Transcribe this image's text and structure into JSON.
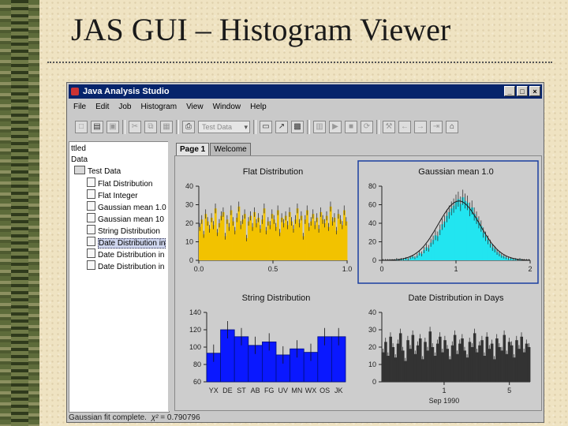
{
  "slide": {
    "title": "JAS GUI – Histogram Viewer"
  },
  "window": {
    "title": "Java Analysis Studio",
    "buttons": [
      "_",
      "□",
      "×"
    ]
  },
  "menu": [
    "File",
    "Edit",
    "Job",
    "Histogram",
    "View",
    "Window",
    "Help"
  ],
  "toolbar": {
    "combo_value": "Test Data"
  },
  "tree": {
    "root": "ttled",
    "data_label": "Data",
    "folder": "Test Data",
    "items": [
      "Flat Distribution",
      "Flat Integer",
      "Gaussian mean 1.0",
      "Gaussian mean 10",
      "String Distribution",
      "Date Distribution in",
      "Date Distribution in",
      "Date Distribution in"
    ],
    "selected_index": 5
  },
  "tabs": [
    "Page 1",
    "Welcome"
  ],
  "status": {
    "prefix": "Gaussian fit complete.",
    "symbol": "χ²",
    "value": "= 0.790796"
  },
  "colors": {
    "flat": "#f2c200",
    "gaussian": "#22e5f0",
    "string": "#0a18ff",
    "date": "#333333",
    "select_box": "#1b3fa0"
  },
  "chart_data": [
    {
      "type": "bar",
      "title": "Flat Distribution",
      "ylim": [
        0,
        40
      ],
      "yticks": [
        "40",
        "30",
        "20",
        "10",
        "0"
      ],
      "xlim": [
        0,
        1
      ],
      "xticks": [
        "0.0",
        "0.5",
        "1.0"
      ],
      "values": [
        18,
        22,
        14,
        25,
        21,
        17,
        23,
        19,
        28,
        15,
        20,
        24,
        26,
        13,
        22,
        18,
        27,
        21,
        16,
        23,
        29,
        19,
        22,
        25,
        12,
        21,
        24,
        18,
        26,
        20,
        23,
        17,
        22,
        28,
        16,
        21,
        19,
        25,
        22,
        18,
        27,
        15,
        23,
        20,
        24,
        19,
        26,
        21,
        17,
        22,
        28,
        20,
        24,
        13,
        22,
        27,
        18,
        21,
        25,
        19,
        23,
        17,
        26,
        22,
        20,
        24,
        18,
        29,
        21,
        23,
        16,
        25,
        22,
        19,
        27,
        21
      ]
    },
    {
      "type": "bar",
      "title": "Gaussian mean 1.0",
      "ylim": [
        0,
        80
      ],
      "yticks": [
        "80",
        "60",
        "40",
        "20",
        "0"
      ],
      "xlim": [
        0,
        2
      ],
      "xticks": [
        "0",
        "1",
        "2"
      ],
      "fit_line": true,
      "values": [
        0,
        0,
        0,
        0,
        0,
        0,
        1,
        0,
        1,
        1,
        2,
        1,
        3,
        4,
        3,
        5,
        8,
        7,
        11,
        14,
        13,
        19,
        22,
        27,
        26,
        33,
        39,
        42,
        48,
        52,
        56,
        59,
        63,
        66,
        61,
        68,
        64,
        62,
        55,
        57,
        50,
        46,
        41,
        37,
        30,
        26,
        22,
        18,
        14,
        12,
        9,
        7,
        5,
        4,
        3,
        2,
        2,
        1,
        1,
        0,
        1,
        0,
        0,
        0,
        0
      ]
    },
    {
      "type": "bar",
      "title": "String Distribution",
      "ylim": [
        60,
        140
      ],
      "yticks": [
        "140",
        "120",
        "100",
        "80",
        "60"
      ],
      "categories": [
        "YX",
        "DE",
        "ST",
        "AB",
        "FG",
        "UV",
        "MN",
        "WX",
        "OS",
        "JK"
      ],
      "values": [
        93,
        120,
        112,
        102,
        106,
        91,
        98,
        94,
        112,
        112
      ]
    },
    {
      "type": "bar",
      "title": "Date Distribution in Days",
      "ylim": [
        0,
        40
      ],
      "yticks": [
        "40",
        "30",
        "20",
        "10",
        "0"
      ],
      "xticks": [
        "1",
        "5"
      ],
      "xlabel": "Sep 1990",
      "values": [
        17,
        23,
        15,
        26,
        20,
        14,
        22,
        28,
        18,
        12,
        24,
        19,
        27,
        16,
        21,
        25,
        13,
        23,
        18,
        29,
        20,
        15,
        22,
        26,
        17,
        24,
        19,
        13,
        21,
        27,
        16,
        22,
        25,
        18,
        14,
        23,
        20,
        28,
        17,
        21,
        24,
        15,
        26,
        19,
        22,
        13,
        25,
        20,
        18,
        27,
        16,
        23,
        21,
        14,
        24,
        19,
        26,
        17,
        22,
        20
      ]
    }
  ]
}
